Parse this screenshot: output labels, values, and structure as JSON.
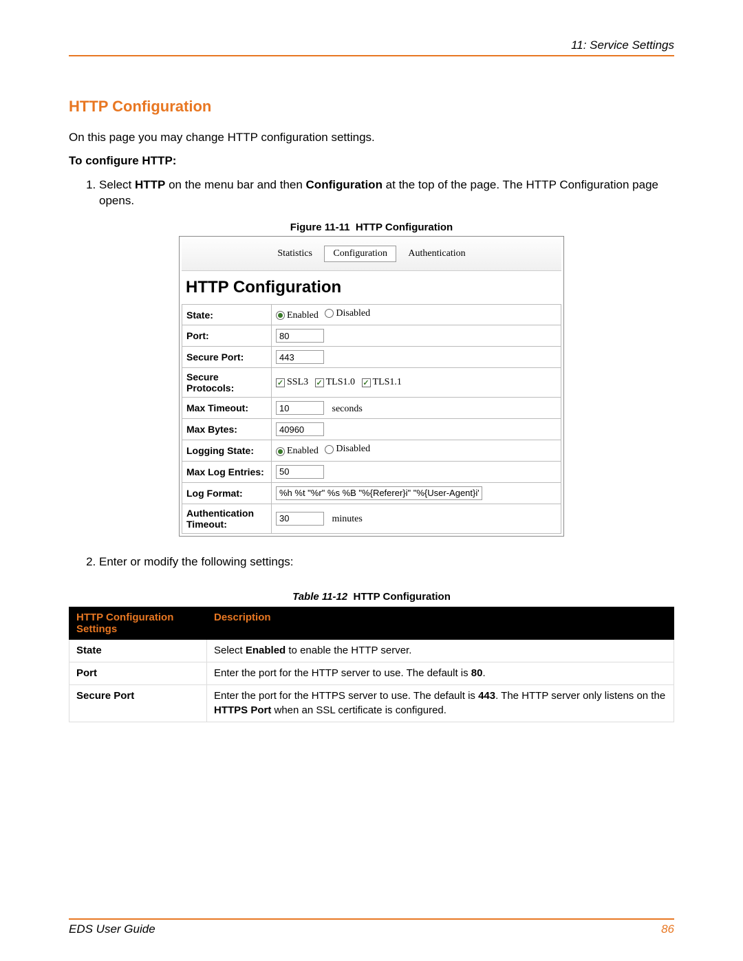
{
  "header": {
    "section_label": "11: Service Settings"
  },
  "title": "HTTP Configuration",
  "intro": "On this page you may change HTTP configuration settings.",
  "subhead": "To configure HTTP:",
  "step1": {
    "pre": "Select ",
    "b1": "HTTP",
    "mid": " on the menu bar and then ",
    "b2": "Configuration",
    "post": " at the top of the page. The HTTP Configuration page opens."
  },
  "figure": {
    "num": "Figure 11-11",
    "title": "HTTP Configuration"
  },
  "panel": {
    "tabs": {
      "statistics": "Statistics",
      "configuration": "Configuration",
      "authentication": "Authentication"
    },
    "title": "HTTP Configuration",
    "rows": {
      "state": {
        "label": "State:",
        "enabled": "Enabled",
        "disabled": "Disabled"
      },
      "port": {
        "label": "Port:",
        "value": "80"
      },
      "secure_port": {
        "label": "Secure Port:",
        "value": "443"
      },
      "secure_protocols": {
        "label": "Secure Protocols:",
        "ssl3": "SSL3",
        "tls10": "TLS1.0",
        "tls11": "TLS1.1"
      },
      "max_timeout": {
        "label": "Max Timeout:",
        "value": "10",
        "unit": "seconds"
      },
      "max_bytes": {
        "label": "Max Bytes:",
        "value": "40960"
      },
      "logging_state": {
        "label": "Logging State:",
        "enabled": "Enabled",
        "disabled": "Disabled"
      },
      "max_log_entries": {
        "label": "Max Log Entries:",
        "value": "50"
      },
      "log_format": {
        "label": "Log Format:",
        "value": "%h %t \"%r\" %s %B \"%{Referer}i\" \"%{User-Agent}i\""
      },
      "auth_timeout": {
        "label": "Authentication Timeout:",
        "value": "30",
        "unit": "minutes"
      }
    }
  },
  "step2": "Enter or modify the following settings:",
  "table_caption": {
    "num": "Table 11-12",
    "title": "HTTP Configuration"
  },
  "desc_table": {
    "head": {
      "col1": "HTTP Configuration Settings",
      "col2": "Description"
    },
    "rows": [
      {
        "setting": "State",
        "pre": "Select ",
        "b1": "Enabled",
        "post": " to enable the HTTP server."
      },
      {
        "setting": "Port",
        "pre": "Enter the port for the HTTP server to use. The default is ",
        "b1": "80",
        "post": "."
      },
      {
        "setting": "Secure Port",
        "pre": "Enter the port for the HTTPS server to use. The default is ",
        "b1": "443",
        "mid": ". The HTTP server only listens on the ",
        "b2": "HTTPS Port",
        "post": " when an SSL certificate is configured."
      }
    ]
  },
  "footer": {
    "guide": "EDS User Guide",
    "page": "86"
  }
}
